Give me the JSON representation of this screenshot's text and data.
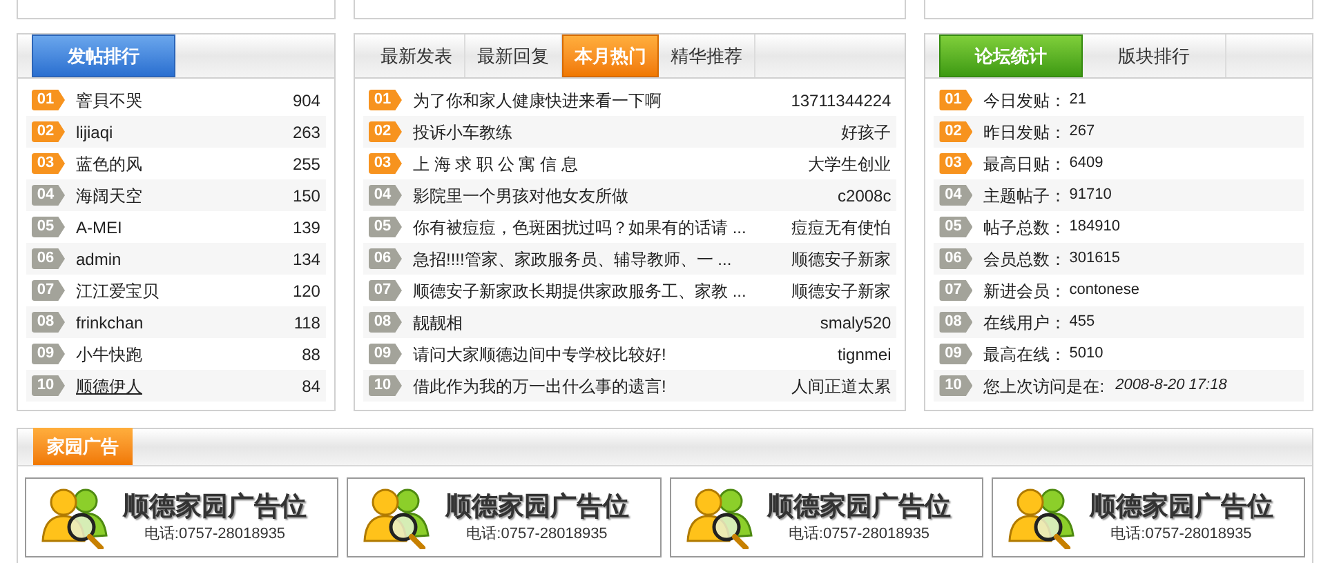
{
  "poster_ranking": {
    "kind": "blue",
    "tabs": [
      {
        "label": "发帖排行",
        "selected": true
      }
    ],
    "rows": [
      {
        "rank": "01",
        "hot": true,
        "name": "窨貝不哭",
        "count": "904",
        "link": false
      },
      {
        "rank": "02",
        "hot": true,
        "name": "lijiaqi",
        "count": "263",
        "link": false
      },
      {
        "rank": "03",
        "hot": true,
        "name": "蓝色的风",
        "count": "255",
        "link": false
      },
      {
        "rank": "04",
        "hot": false,
        "name": "海阔天空",
        "count": "150",
        "link": false
      },
      {
        "rank": "05",
        "hot": false,
        "name": "A-MEI",
        "count": "139",
        "link": false
      },
      {
        "rank": "06",
        "hot": false,
        "name": "admin",
        "count": "134",
        "link": false
      },
      {
        "rank": "07",
        "hot": false,
        "name": "江江爱宝贝",
        "count": "120",
        "link": false
      },
      {
        "rank": "08",
        "hot": false,
        "name": "frinkchan",
        "count": "118",
        "link": false
      },
      {
        "rank": "09",
        "hot": false,
        "name": "小牛快跑",
        "count": "88",
        "link": false
      },
      {
        "rank": "10",
        "hot": false,
        "name": "顺德伊人",
        "count": "84",
        "link": true
      }
    ]
  },
  "hot_topics": {
    "kind": "orange",
    "tabs": [
      {
        "label": "最新发表",
        "selected": false
      },
      {
        "label": "最新回复",
        "selected": false
      },
      {
        "label": "本月热门",
        "selected": true
      },
      {
        "label": "精华推荐",
        "selected": false
      }
    ],
    "rows": [
      {
        "rank": "01",
        "hot": true,
        "name": "为了你和家人健康快进来看一下啊",
        "count": "13711344224",
        "link": false
      },
      {
        "rank": "02",
        "hot": true,
        "name": "投诉小车教练",
        "count": "好孩子",
        "link": false
      },
      {
        "rank": "03",
        "hot": true,
        "name": "上 海 求 职 公 寓 信 息",
        "count": "大学生创业",
        "link": false
      },
      {
        "rank": "04",
        "hot": false,
        "name": "影院里一个男孩对他女友所做",
        "count": "c2008c",
        "link": false
      },
      {
        "rank": "05",
        "hot": false,
        "name": "你有被痘痘，色斑困扰过吗？如果有的话请 ...",
        "count": "痘痘无有使怕",
        "link": false
      },
      {
        "rank": "06",
        "hot": false,
        "name": "急招!!!!管家、家政服务员、辅导教师、一 ...",
        "count": "顺德安子新家",
        "link": false
      },
      {
        "rank": "07",
        "hot": false,
        "name": "顺德安子新家政长期提供家政服务工、家教 ...",
        "count": "顺德安子新家",
        "link": false
      },
      {
        "rank": "08",
        "hot": false,
        "name": "靓靓相",
        "count": "smaly520",
        "link": false
      },
      {
        "rank": "09",
        "hot": false,
        "name": "请问大家顺德边间中专学校比较好!",
        "count": "tignmei",
        "link": false
      },
      {
        "rank": "10",
        "hot": false,
        "name": "借此作为我的万一出什么事的遗言!",
        "count": "人间正道太累",
        "link": false
      }
    ]
  },
  "forum_stats": {
    "kind": "green",
    "tabs": [
      {
        "label": "论坛统计",
        "selected": true
      },
      {
        "label": "版块排行",
        "selected": false
      }
    ],
    "rows": [
      {
        "rank": "01",
        "hot": true,
        "kind": "stat",
        "label": "今日发贴：",
        "value": "21"
      },
      {
        "rank": "02",
        "hot": true,
        "kind": "stat",
        "label": "昨日发贴：",
        "value": "267"
      },
      {
        "rank": "03",
        "hot": true,
        "kind": "stat",
        "label": "最高日贴：",
        "value": "6409"
      },
      {
        "rank": "04",
        "hot": false,
        "kind": "stat",
        "label": "主题帖子：",
        "value": "91710"
      },
      {
        "rank": "05",
        "hot": false,
        "kind": "stat",
        "label": "帖子总数：",
        "value": "184910"
      },
      {
        "rank": "06",
        "hot": false,
        "kind": "stat",
        "label": "会员总数：",
        "value": "301615"
      },
      {
        "rank": "07",
        "hot": false,
        "kind": "stat",
        "label": "新进会员：",
        "value": "contonese"
      },
      {
        "rank": "08",
        "hot": false,
        "kind": "stat",
        "label": "在线用户：",
        "value": "455"
      },
      {
        "rank": "09",
        "hot": false,
        "kind": "stat",
        "label": "最高在线：",
        "value": "5010"
      },
      {
        "rank": "10",
        "hot": false,
        "kind": "time",
        "label": "您上次访问是在:",
        "value": "2008-8-20 17:18"
      }
    ]
  },
  "ads": {
    "title": "家园广告",
    "items": [
      {
        "title": "顺德家园广告位",
        "phone": "电话:0757-28018935"
      },
      {
        "title": "顺德家园广告位",
        "phone": "电话:0757-28018935"
      },
      {
        "title": "顺德家园广告位",
        "phone": "电话:0757-28018935"
      },
      {
        "title": "顺德家园广告位",
        "phone": "电话:0757-28018935"
      }
    ]
  }
}
